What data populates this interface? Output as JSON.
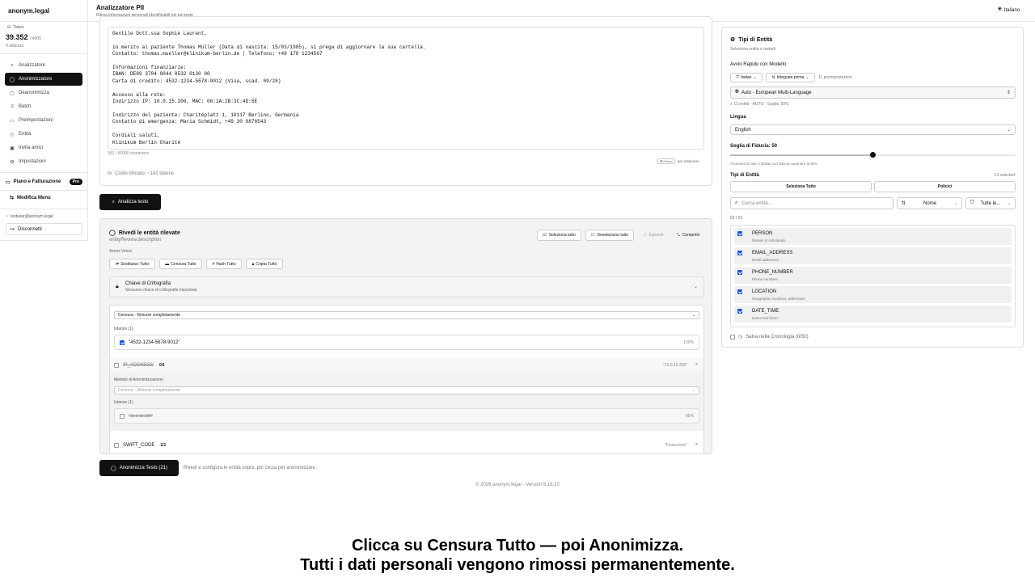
{
  "sidebar": {
    "brand": "anonym.legal",
    "tokens_label": "Token",
    "tokens_value": "39.352",
    "tokens_total": "/ 4000",
    "tokens_used": "0 utilizzati",
    "nav": [
      {
        "label": "Analizzatore",
        "icon": "search-icon"
      },
      {
        "label": "Anonimizzatore",
        "icon": "shield-icon"
      },
      {
        "label": "Deanonimizza",
        "icon": "unlock-icon"
      },
      {
        "label": "Batch",
        "icon": "layers-icon"
      },
      {
        "label": "Preimpostazioni",
        "icon": "bookmark-icon"
      },
      {
        "label": "Entità",
        "icon": "tag-icon"
      },
      {
        "label": "Invita amici",
        "icon": "gift-icon"
      },
      {
        "label": "Impostazioni",
        "icon": "gear-icon"
      }
    ],
    "plan_label": "Piano e Fatturazione",
    "plan_badge": "Pro",
    "edit_menu": "Modifica Menu",
    "user_email": "testuser@anonym.legal",
    "logout": "Disconnetti"
  },
  "header": {
    "title": "Analizzatore PII",
    "subtitle": "Rileva informazioni personali identificabili nel tuo testo",
    "language": "Italiano"
  },
  "input": {
    "text": "Gentile Dott.ssa Sophie Laurent,\n\nin merito al paziente Thomas Müller (Data di nascita: 15/03/1985), si prega di aggiornare la sua cartella.\nContatto: thomas.mueller@klinikum-berlin.de | Telefono: +49 170 1234567\n\nInformazioni finanziarie:\nIBAN: DE89 3704 0044 0532 0130 00\nCarta di credito: 4532-1234-5678-9012 (Visa, scad. 09/28)\n\nAccesso alla rete:\nIndirizzo IP: 10.0.15.200, MAC: 00:1A:2B:3C:4D:5E\n\nIndirizzo del paziente: Charitéplatz 1, 10117 Berlino, Germania\nContatto di emergenza: Maria Schmidt, +49 30 9876543\n\nCordiali saluti,\nKlinikum Berlin Charité",
    "char_count": "581 / 50000 characters",
    "kbd_hint_key": "⌘+Enter",
    "kbd_hint": "per elaborare",
    "cost": "Costo stimato: ~141 tokens",
    "analyze_button": "Analizza testo"
  },
  "review": {
    "title": "Rivedi le entità rilevate",
    "description": "entityReview.description",
    "select_all": "Seleziona tutto",
    "deselect_all": "Deseleziona tutto",
    "expand": "Espandi",
    "collapse": "Comprimi",
    "quick_actions_label": "Azioni Veloci",
    "quick_actions": [
      "Sostituisci Tutto",
      "Censura Tutto",
      "Hash Tutto",
      "Cripta Tutto"
    ],
    "crypto_title": "Chiave di Crittografia",
    "crypto_sub": "Nessuna chiave di crittografia impostata",
    "method_selected": "Censura - Rimuovi completamente",
    "instances_label_1": "Istanze (1)",
    "instance_1": "\"4532-1234-5678-9012\"",
    "instance_1_pct": "100%",
    "group_ip": "IP_ADDRESS",
    "group_ip_count": "0/1",
    "group_ip_value": "\"10.0.15.200\"",
    "method_label": "Metodo di Anonimizzazione",
    "method_selected_2": "Censura - Rimuovi completamente",
    "instances_label_2": "Istanze (1)",
    "instance_2": "\"10.0.15.200\"",
    "instance_2_pct": "95%",
    "group_swift": "SWIFT_CODE",
    "group_swift_count": "1/1",
    "group_swift_value": "\"Finanziarie\""
  },
  "anonymize": {
    "button": "Anonimizza Testo (21)",
    "hint": "Rivedi e configura le entità sopra, poi clicca per anonimizzare."
  },
  "footer": "© 2026 anonym.legal · Version 5.18.20",
  "panel": {
    "title": "Tipi di Entità",
    "subtitle": "Seleziona entità e metodi",
    "quick_start": "Avvio Rapido con Modello",
    "pill_lang": "Italian",
    "pill_integrations": "Integrate prima",
    "presets": "11 preimpostazioni",
    "model": "Auto - European Multi-Language",
    "model_info": "13 entità · AUTO · Soglia: 50%",
    "lingua_label": "Lingua",
    "lingua_value": "English",
    "threshold_label": "Soglia di Fiducia: 50",
    "threshold": 0.5,
    "threshold_hint": "Anonimizza solo i risultati con fiducia superiore al 50%",
    "types_label": "Tipi di Entità",
    "types_selected": "13 selected",
    "select_all": "Seleziona Tutto",
    "policies": "Policici",
    "search_placeholder": "Cerca entità...",
    "sort_value": "Nome",
    "filter_value": "Tutte le...",
    "count": "63 / 63",
    "entities": [
      {
        "name": "PERSON",
        "desc": "Names of individuals"
      },
      {
        "name": "EMAIL_ADDRESS",
        "desc": "Email addresses"
      },
      {
        "name": "PHONE_NUMBER",
        "desc": "Phone numbers"
      },
      {
        "name": "LOCATION",
        "desc": "Geographic locations, addresses"
      },
      {
        "name": "DATE_TIME",
        "desc": "Dates and times"
      }
    ],
    "save_history": "Salva nella Cronologia (0/50)"
  },
  "caption": {
    "line1": "Clicca su Censura Tutto — poi Anonimizza.",
    "line2": "Tutti i dati personali vengono rimossi permanentemente."
  }
}
